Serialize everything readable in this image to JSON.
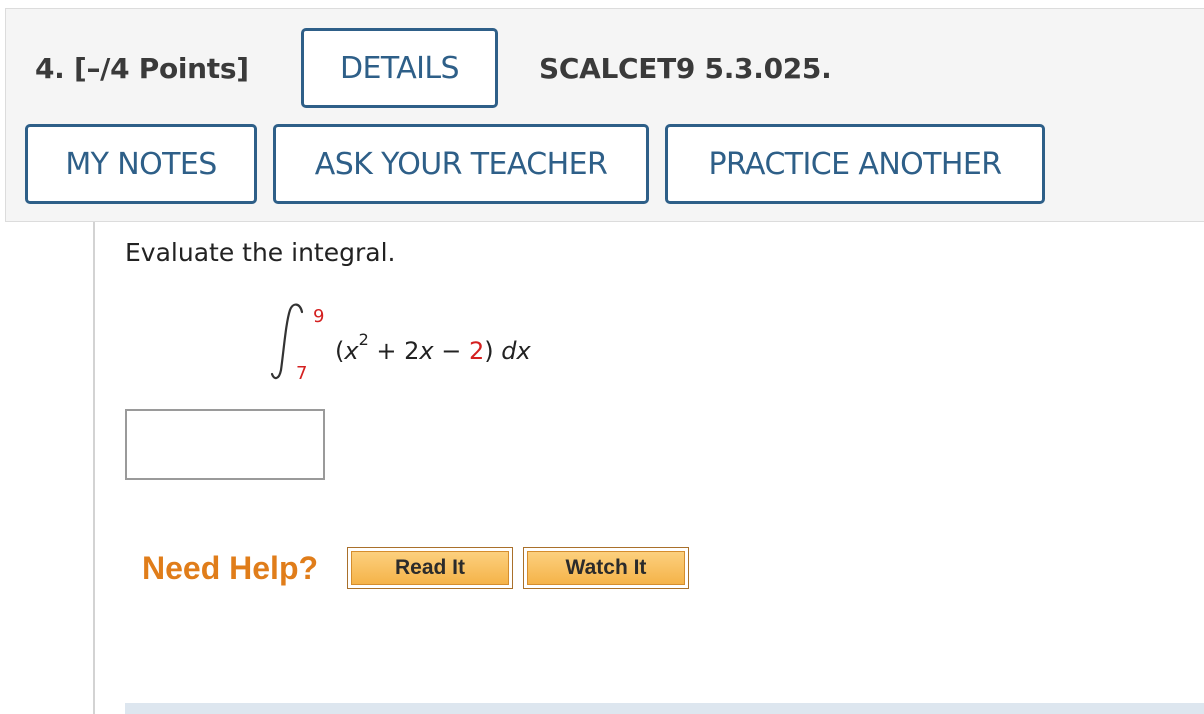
{
  "header": {
    "question_title": "4.  [–/4 Points]",
    "details_label": "DETAILS",
    "problem_code": "SCALCET9 5.3.025.",
    "my_notes_label": "MY NOTES",
    "ask_teacher_label": "ASK YOUR TEACHER",
    "practice_another_label": "PRACTICE ANOTHER"
  },
  "question": {
    "prompt": "Evaluate the integral.",
    "upper_limit": "9",
    "lower_limit": "7",
    "integrand": {
      "open": "(",
      "var": "x",
      "exponent": "2",
      "middle": " + 2",
      "var2": "x",
      "minus": " − ",
      "constant": "2",
      "close": ") ",
      "differential": "dx"
    },
    "answer_value": ""
  },
  "help": {
    "label": "Need Help?",
    "read_it_label": "Read It",
    "watch_it_label": "Watch It"
  },
  "colors": {
    "button_blue": "#2e5f88",
    "highlight_red": "#d42020",
    "help_orange": "#e07d1a",
    "help_button_fill": "#f5b349"
  }
}
